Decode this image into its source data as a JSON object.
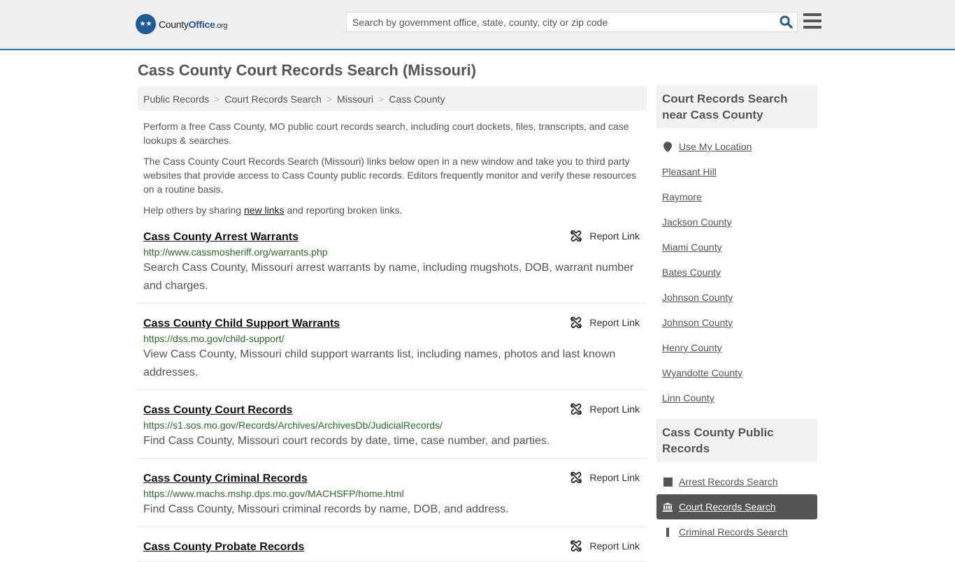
{
  "header": {
    "logo_name": "County",
    "logo_office": "Office",
    "logo_tld": ".org",
    "search_placeholder": "Search by government office, state, county, city or zip code"
  },
  "page_title": "Cass County Court Records Search (Missouri)",
  "breadcrumb": [
    "Public Records",
    "Court Records Search",
    "Missouri",
    "Cass County"
  ],
  "intro": {
    "p1": "Perform a free Cass County, MO public court records search, including court dockets, files, transcripts, and case lookups & searches.",
    "p2": "The Cass County Court Records Search (Missouri) links below open in a new window and take you to third party websites that provide access to Cass County public records. Editors frequently monitor and verify these resources on a routine basis.",
    "p3_before": "Help others by sharing ",
    "p3_link": "new links",
    "p3_after": " and reporting broken links."
  },
  "report_label": "Report Link",
  "entries": [
    {
      "title": "Cass County Arrest Warrants",
      "url": "http://www.cassmosheriff.org/warrants.php",
      "desc": "Search Cass County, Missouri arrest warrants by name, including mugshots, DOB, warrant number and charges."
    },
    {
      "title": "Cass County Child Support Warrants",
      "url": "https://dss.mo.gov/child-support/",
      "desc": "View Cass County, Missouri child support warrants list, including names, photos and last known addresses."
    },
    {
      "title": "Cass County Court Records",
      "url": "https://s1.sos.mo.gov/Records/Archives/ArchivesDb/JudicialRecords/",
      "desc": "Find Cass County, Missouri court records by date, time, case number, and parties."
    },
    {
      "title": "Cass County Criminal Records",
      "url": "https://www.machs.mshp.dps.mo.gov/MACHSFP/home.html",
      "desc": "Find Cass County, Missouri criminal records by name, DOB, and address."
    },
    {
      "title": "Cass County Probate Records",
      "url": "",
      "desc": ""
    }
  ],
  "sidebar": {
    "nearby_heading": "Court Records Search near Cass County",
    "use_location": "Use My Location",
    "nearby": [
      "Pleasant Hill",
      "Raymore",
      "Jackson County",
      "Miami County",
      "Bates County",
      "Johnson County",
      "Johnson County",
      "Henry County",
      "Wyandotte County",
      "Linn County"
    ],
    "public_heading": "Cass County Public Records",
    "public_records": [
      {
        "label": "Arrest Records Search",
        "icon": "square-icon",
        "active": false
      },
      {
        "label": "Court Records Search",
        "icon": "courthouse-icon",
        "active": true
      },
      {
        "label": "Criminal Records Search",
        "icon": "bar-icon",
        "active": false
      }
    ]
  }
}
